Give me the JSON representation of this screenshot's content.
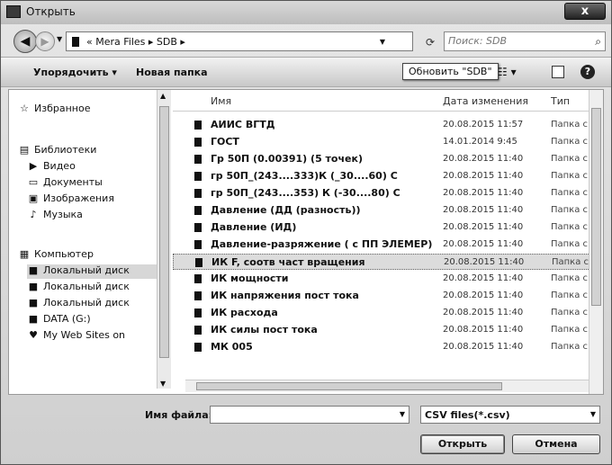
{
  "window": {
    "title": "Открыть",
    "close_label": "x"
  },
  "nav": {
    "back_glyph": "◀",
    "forward_glyph": "▶",
    "breadcrumb": "« Mera Files  ▸  SDB  ▸",
    "search_placeholder": "Поиск: SDB",
    "refresh_glyph": "⟳"
  },
  "toolbar": {
    "organize_label": "Упорядочить ▾",
    "new_folder_label": "Новая папка",
    "tooltip": "Обновить \"SDB\"",
    "views_glyph": "☷ ▾",
    "help_glyph": "?"
  },
  "sidebar": {
    "items": [
      {
        "label": "Избранное",
        "icon": "star-icon",
        "glyph": "☆"
      },
      {
        "label": "Библиотеки",
        "icon": "library-icon",
        "glyph": "▤"
      },
      {
        "label": "Видео",
        "icon": "video-icon",
        "glyph": "▶"
      },
      {
        "label": "Документы",
        "icon": "documents-icon",
        "glyph": "▭"
      },
      {
        "label": "Изображения",
        "icon": "pictures-icon",
        "glyph": "▣"
      },
      {
        "label": "Музыка",
        "icon": "music-icon",
        "glyph": "♪"
      },
      {
        "label": "Компьютер",
        "icon": "computer-icon",
        "glyph": "▦"
      },
      {
        "label": "Локальный диск",
        "icon": "drive-icon",
        "glyph": "■"
      },
      {
        "label": "Локальный диск",
        "icon": "drive-icon",
        "glyph": "■"
      },
      {
        "label": "Локальный диск",
        "icon": "drive-icon",
        "glyph": "■"
      },
      {
        "label": "DATA (G:)",
        "icon": "drive-icon",
        "glyph": "■"
      },
      {
        "label": "My Web Sites on",
        "icon": "web-icon",
        "glyph": "♥"
      }
    ]
  },
  "columns": {
    "name": "Имя",
    "date": "Дата изменения",
    "type": "Тип"
  },
  "files": [
    {
      "name": "АИИС ВГТД",
      "date": "20.08.2015 11:57",
      "type": "Папка с ф"
    },
    {
      "name": "ГОСТ",
      "date": "14.01.2014 9:45",
      "type": "Папка с ф"
    },
    {
      "name": "Гр 50П (0.00391) (5 точек)",
      "date": "20.08.2015 11:40",
      "type": "Папка с ф"
    },
    {
      "name": "гр 50П_(243....333)К (_30....60) С",
      "date": "20.08.2015 11:40",
      "type": "Папка с ф"
    },
    {
      "name": "гр 50П_(243....353) К (-30....80) С",
      "date": "20.08.2015 11:40",
      "type": "Папка с ф"
    },
    {
      "name": "Давление (ДД (разность))",
      "date": "20.08.2015 11:40",
      "type": "Папка с ф"
    },
    {
      "name": "Давление (ИД)",
      "date": "20.08.2015 11:40",
      "type": "Папка с ф"
    },
    {
      "name": "Давление-разряжение ( с ПП ЭЛЕМЕР)",
      "date": "20.08.2015 11:40",
      "type": "Папка с ф"
    },
    {
      "name": "ИК F, соотв част вращения",
      "date": "20.08.2015 11:40",
      "type": "Папка с ф"
    },
    {
      "name": "ИК мощности",
      "date": "20.08.2015 11:40",
      "type": "Папка с ф"
    },
    {
      "name": "ИК напряжения пост тока",
      "date": "20.08.2015 11:40",
      "type": "Папка с ф"
    },
    {
      "name": "ИК расхода",
      "date": "20.08.2015 11:40",
      "type": "Папка с ф"
    },
    {
      "name": "ИК силы пост тока",
      "date": "20.08.2015 11:40",
      "type": "Папка с ф"
    },
    {
      "name": "МК 005",
      "date": "20.08.2015 11:40",
      "type": "Папка с ф"
    }
  ],
  "bottom": {
    "filename_label": "Имя файла:",
    "filename_value": "",
    "filetype_value": "CSV files(*.csv)",
    "open_label": "Открыть",
    "cancel_label": "Отмена"
  }
}
